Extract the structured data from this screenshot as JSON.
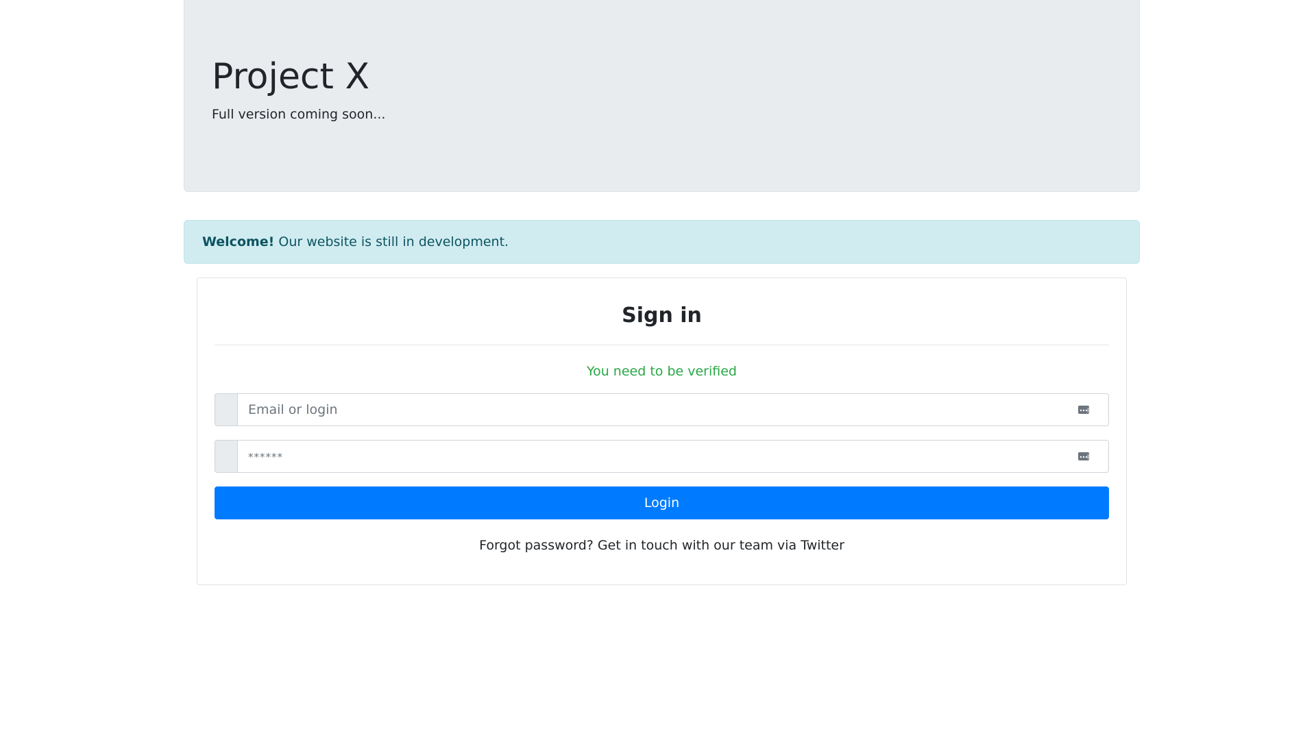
{
  "header": {
    "title": "Project X",
    "subtitle": "Full version coming soon..."
  },
  "alert": {
    "strong": "Welcome!",
    "text": " Our website is still in development."
  },
  "signin": {
    "title": "Sign in",
    "status": "You need to be verified",
    "login_field": {
      "placeholder": "Email or login",
      "value": ""
    },
    "password_field": {
      "placeholder": "******",
      "value": ""
    },
    "login_button": "Login",
    "forgot_text": "Forgot password? Get in touch with our team via Twitter"
  },
  "colors": {
    "primary": "#007bff",
    "success": "#28a745",
    "info_bg": "#d1ecf1",
    "info_text": "#0c5460",
    "jumbotron_bg": "#e9ecef"
  },
  "icons": {
    "field_icon": "password-manager-icon"
  }
}
